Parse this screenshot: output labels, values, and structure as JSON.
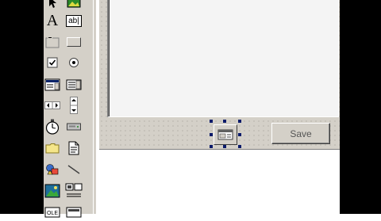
{
  "toolbox": {
    "tools": [
      {
        "name": "pointer-icon"
      },
      {
        "name": "picture-icon"
      },
      {
        "name": "label-icon",
        "glyph": "A"
      },
      {
        "name": "textbox-icon",
        "glyph": "ab|"
      },
      {
        "name": "frame-icon"
      },
      {
        "name": "commandbutton-icon"
      },
      {
        "name": "checkbox-icon"
      },
      {
        "name": "optionbutton-icon"
      },
      {
        "name": "combobox-icon"
      },
      {
        "name": "listbox-icon"
      },
      {
        "name": "hscrollbar-icon"
      },
      {
        "name": "vscrollbar-icon"
      },
      {
        "name": "timer-icon"
      },
      {
        "name": "drivelistbox-icon"
      },
      {
        "name": "dirlistbox-icon"
      },
      {
        "name": "filelistbox-icon"
      },
      {
        "name": "shape-icon"
      },
      {
        "name": "line-icon"
      },
      {
        "name": "image-icon"
      },
      {
        "name": "data-icon"
      },
      {
        "name": "ole-icon"
      },
      {
        "name": "extra-control-icon"
      }
    ]
  },
  "form": {
    "save_label": "Save"
  },
  "colors": {
    "face": "#d4d0c8",
    "handle": "#0a1a6a",
    "listbox": "#f4f4f4"
  }
}
